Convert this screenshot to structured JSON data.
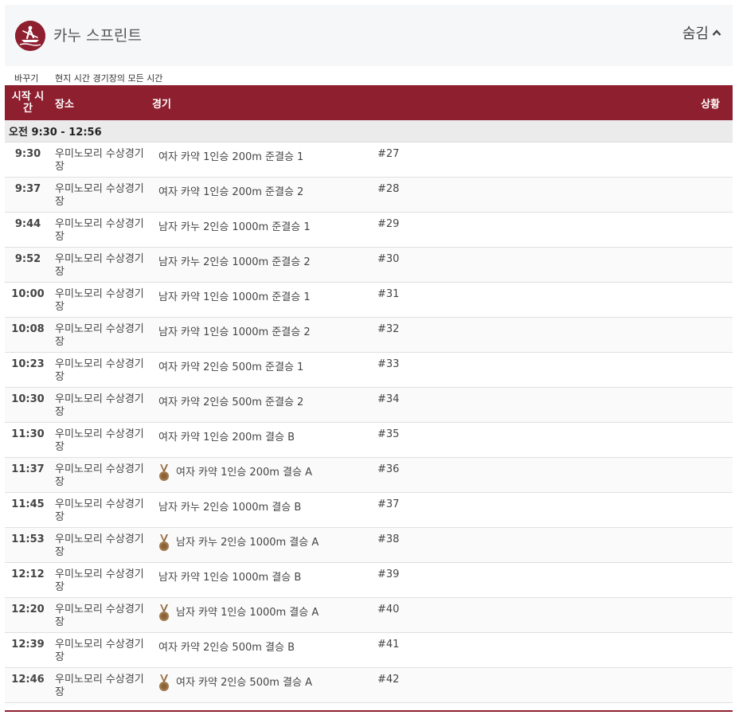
{
  "header": {
    "title": "카누 스프린트",
    "toggle_label": "숨김"
  },
  "timezone": {
    "switch_label": "바꾸기",
    "current_label": "현지 시간 경기장의 모든 시간"
  },
  "columns": {
    "time": "시작 시간",
    "venue": "장소",
    "event": "경기",
    "status": "상황"
  },
  "colors": {
    "brand": "#8e1f2f",
    "medal": "#a0784a"
  },
  "section": {
    "label": "오전  9:30 - 12:56"
  },
  "rows": [
    {
      "time": "9:30",
      "venue": "우미노모리 수상경기장",
      "event": "여자 카약 1인승 200m 준결승 1",
      "number": "#27",
      "medal": false
    },
    {
      "time": "9:37",
      "venue": "우미노모리 수상경기장",
      "event": "여자 카약 1인승 200m 준결승 2",
      "number": "#28",
      "medal": false
    },
    {
      "time": "9:44",
      "venue": "우미노모리 수상경기장",
      "event": "남자 카누 2인승 1000m 준결승 1",
      "number": "#29",
      "medal": false
    },
    {
      "time": "9:52",
      "venue": "우미노모리 수상경기장",
      "event": "남자 카누 2인승 1000m 준결승 2",
      "number": "#30",
      "medal": false
    },
    {
      "time": "10:00",
      "venue": "우미노모리 수상경기장",
      "event": "남자 카약 1인승 1000m 준결승 1",
      "number": "#31",
      "medal": false
    },
    {
      "time": "10:08",
      "venue": "우미노모리 수상경기장",
      "event": "남자 카약 1인승 1000m 준결승 2",
      "number": "#32",
      "medal": false
    },
    {
      "time": "10:23",
      "venue": "우미노모리 수상경기장",
      "event": "여자 카약 2인승 500m 준결승 1",
      "number": "#33",
      "medal": false
    },
    {
      "time": "10:30",
      "venue": "우미노모리 수상경기장",
      "event": "여자 카약 2인승 500m 준결승 2",
      "number": "#34",
      "medal": false
    },
    {
      "time": "11:30",
      "venue": "우미노모리 수상경기장",
      "event": "여자 카약 1인승 200m 결승 B",
      "number": "#35",
      "medal": false
    },
    {
      "time": "11:37",
      "venue": "우미노모리 수상경기장",
      "event": "여자 카약 1인승 200m 결승 A",
      "number": "#36",
      "medal": true
    },
    {
      "time": "11:45",
      "venue": "우미노모리 수상경기장",
      "event": "남자 카누 2인승 1000m 결승 B",
      "number": "#37",
      "medal": false
    },
    {
      "time": "11:53",
      "venue": "우미노모리 수상경기장",
      "event": "남자 카누 2인승 1000m 결승 A",
      "number": "#38",
      "medal": true
    },
    {
      "time": "12:12",
      "venue": "우미노모리 수상경기장",
      "event": "남자 카약 1인승 1000m 결승 B",
      "number": "#39",
      "medal": false
    },
    {
      "time": "12:20",
      "venue": "우미노모리 수상경기장",
      "event": "남자 카약 1인승 1000m 결승 A",
      "number": "#40",
      "medal": true
    },
    {
      "time": "12:39",
      "venue": "우미노모리 수상경기장",
      "event": "여자 카약 2인승 500m 결승 B",
      "number": "#41",
      "medal": false
    },
    {
      "time": "12:46",
      "venue": "우미노모리 수상경기장",
      "event": "여자 카약 2인승 500m 결승 A",
      "number": "#42",
      "medal": true
    }
  ]
}
